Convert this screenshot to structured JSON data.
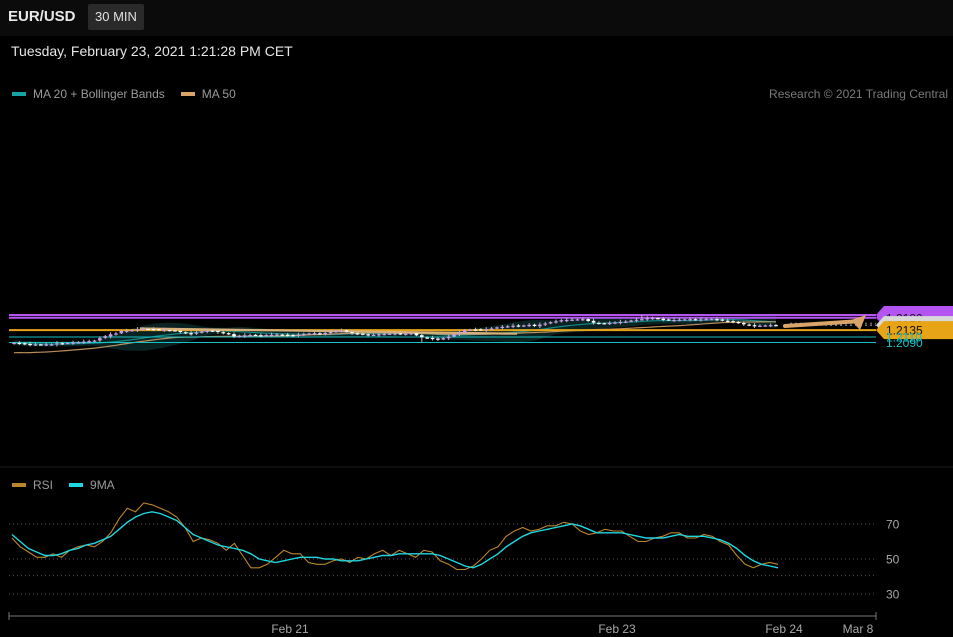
{
  "header": {
    "symbol": "EUR/USD",
    "timeframe": "30 MIN",
    "datetime": "Tuesday, February 23, 2021 1:21:28 PM CET"
  },
  "legend": {
    "ma20_label": "MA 20 + Bollinger Bands",
    "ma50_label": "MA 50",
    "credit": "Research © 2021 Trading Central"
  },
  "rsi_legend": {
    "rsi_label": "RSI",
    "ma9_label": "9MA"
  },
  "colors": {
    "ma20": "#17a3a3",
    "ma50": "#d9a46a",
    "rsi": "#b8862b",
    "ma9": "#1ed8e0",
    "candle_up": "#cc99ee",
    "candle_down": "#ffffff",
    "purple_level": "#b455f2",
    "orange_level": "#e6a416",
    "cyan_level": "#16c2c4",
    "arrow": "#d9a46a"
  },
  "chart_data": [
    {
      "type": "candlestick",
      "title": "EUR/USD 30 MIN",
      "y_range": [
        1.207,
        1.22
      ],
      "x_ticks": [
        "Feb 21",
        "Feb 23",
        "Feb 24",
        "Mar 8"
      ],
      "series": [
        {
          "name": "MA 20 + Bollinger Bands"
        },
        {
          "name": "MA 50"
        }
      ],
      "levels": [
        {
          "value": "1.2190",
          "price": 1.219,
          "style": "purple"
        },
        {
          "value": "1.2180",
          "price": 1.218,
          "style": "purple"
        },
        {
          "value": "1.2153",
          "price": 1.2153,
          "style": "current"
        },
        {
          "value": "1.2135",
          "price": 1.2135,
          "style": "orange"
        },
        {
          "value": "1.2110",
          "price": 1.211,
          "style": "cyan"
        },
        {
          "value": "1.2090",
          "price": 1.209,
          "style": "cyan"
        }
      ],
      "target_arrow": {
        "from": 1.215,
        "to": 1.219
      },
      "trendline": {
        "from": 1.2141,
        "to": 1.2122
      },
      "closes": [
        1.2089,
        1.2087,
        1.2084,
        1.2083,
        1.2083,
        1.2082,
        1.2083,
        1.2083,
        1.2087,
        1.2086,
        1.2088,
        1.209,
        1.2091,
        1.2093,
        1.2095,
        1.2097,
        1.2106,
        1.2113,
        1.212,
        1.2123,
        1.2132,
        1.2133,
        1.2135,
        1.2138,
        1.214,
        1.2139,
        1.2138,
        1.2136,
        1.2136,
        1.2134,
        1.2132,
        1.2128,
        1.2124,
        1.2122,
        1.2126,
        1.213,
        1.2133,
        1.2132,
        1.2128,
        1.2124,
        1.212,
        1.2112,
        1.2114,
        1.2116,
        1.2117,
        1.2117,
        1.2116,
        1.2117,
        1.2118,
        1.2119,
        1.2118,
        1.2116,
        1.2116,
        1.2118,
        1.2121,
        1.2123,
        1.2124,
        1.2122,
        1.2125,
        1.2128,
        1.2132,
        1.2134,
        1.2129,
        1.2124,
        1.2122,
        1.2119,
        1.2118,
        1.2118,
        1.212,
        1.2121,
        1.2122,
        1.2123,
        1.2121,
        1.2122,
        1.2124,
        1.2116,
        1.2109,
        1.2107,
        1.2104,
        1.21,
        1.2106,
        1.2112,
        1.212,
        1.2126,
        1.2134,
        1.2137,
        1.2137,
        1.2136,
        1.2138,
        1.2141,
        1.2145,
        1.2147,
        1.2149,
        1.2151,
        1.215,
        1.2152,
        1.2154,
        1.215,
        1.2155,
        1.2159,
        1.2164,
        1.2167,
        1.2171,
        1.2172,
        1.2173,
        1.2174,
        1.2175,
        1.2168,
        1.2162,
        1.216,
        1.2159,
        1.2161,
        1.2163,
        1.2165,
        1.2166,
        1.217,
        1.2173,
        1.2175,
        1.2178,
        1.2179,
        1.2176,
        1.2173,
        1.2172,
        1.2172,
        1.2173,
        1.2174,
        1.2175,
        1.2173,
        1.2174,
        1.2175,
        1.2175,
        1.2173,
        1.217,
        1.2168,
        1.2165,
        1.216,
        1.2156,
        1.2153,
        1.215,
        1.2151,
        1.2152,
        1.2153,
        1.2153
      ]
    },
    {
      "type": "line",
      "title": "RSI",
      "y_ticks": [
        "70",
        "50",
        "30"
      ],
      "ylim": [
        25,
        85
      ],
      "series": [
        {
          "name": "RSI",
          "values": [
            62,
            57,
            54,
            51,
            51,
            53,
            51,
            55,
            57,
            58,
            57,
            60,
            65,
            73,
            79,
            77,
            82,
            81,
            79,
            77,
            74,
            68,
            60,
            62,
            61,
            59,
            55,
            59,
            52,
            45,
            45,
            47,
            51,
            55,
            53,
            53,
            48,
            47,
            47,
            49,
            50,
            48,
            51,
            50,
            53,
            55,
            52,
            55,
            53,
            51,
            55,
            54,
            49,
            47,
            44,
            44,
            46,
            50,
            55,
            57,
            63,
            66,
            68,
            66,
            67,
            69,
            69,
            71,
            70,
            66,
            64,
            65,
            67,
            66,
            66,
            63,
            60,
            60,
            62,
            63,
            65,
            65,
            62,
            62,
            64,
            63,
            60,
            58,
            52,
            47,
            45,
            47,
            48,
            47
          ]
        },
        {
          "name": "9MA",
          "values": [
            64,
            60,
            56,
            54,
            52,
            52,
            53,
            55,
            56,
            58,
            59,
            61,
            63,
            67,
            71,
            74,
            76,
            77,
            76,
            74,
            72,
            68,
            64,
            62,
            60,
            58,
            57,
            56,
            55,
            53,
            50,
            49,
            48,
            49,
            50,
            51,
            51,
            51,
            50,
            50,
            49,
            49,
            49,
            50,
            51,
            52,
            52,
            53,
            53,
            53,
            53,
            53,
            52,
            50,
            48,
            46,
            45,
            47,
            50,
            53,
            57,
            60,
            63,
            65,
            66,
            67,
            68,
            69,
            70,
            69,
            67,
            65,
            65,
            65,
            65,
            64,
            63,
            62,
            62,
            62,
            63,
            64,
            63,
            63,
            63,
            62,
            61,
            59,
            56,
            52,
            49,
            47,
            46,
            45
          ]
        }
      ]
    }
  ]
}
